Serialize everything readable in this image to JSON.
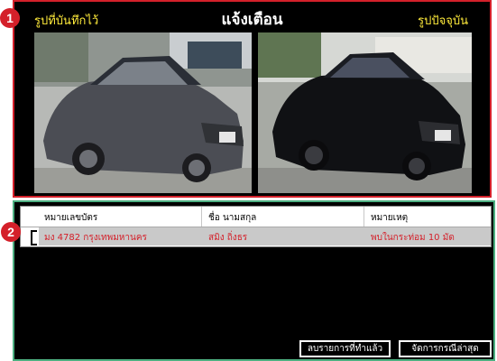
{
  "header": {
    "title": "แจ้งเตือน",
    "left_label": "รูปที่บันทึกไว้",
    "right_label": "รูปปัจจุบัน"
  },
  "markers": {
    "one": "1",
    "two": "2"
  },
  "table": {
    "columns": [
      "หมายเลขบัตร",
      "ชื่อ นามสกุล",
      "หมายเหตุ"
    ],
    "rows": [
      {
        "card": "มง 4782 กรุงเทพมหานคร",
        "name": "สมิง ถิ่งธร",
        "note": "พบในกระท่อม 10 มัด"
      }
    ]
  },
  "buttons": {
    "clear": "ลบรายการที่ทำแล้ว",
    "recent": "จัดการกรณีล่าสุด"
  },
  "colors": {
    "panel_top_border": "#d4202a",
    "panel_bottom_border": "#4caf80",
    "label_yellow": "#ffeb3b",
    "row_text": "#d4202a"
  },
  "icons": {
    "saved_photo": "gray-sedan-photo",
    "current_photo": "black-sedan-photo"
  }
}
